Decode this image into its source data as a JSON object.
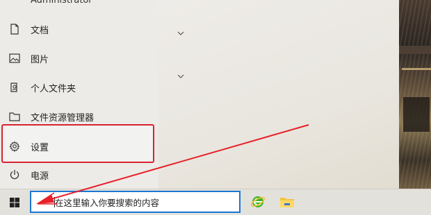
{
  "start_menu": {
    "user_name": "Administrator",
    "items": [
      {
        "label": "文档",
        "icon": "document-icon"
      },
      {
        "label": "图片",
        "icon": "picture-icon"
      },
      {
        "label": "个人文件夹",
        "icon": "user-folder-icon"
      },
      {
        "label": "文件资源管理器",
        "icon": "folder-icon"
      },
      {
        "label": "设置",
        "icon": "gear-icon"
      },
      {
        "label": "电源",
        "icon": "power-icon"
      }
    ]
  },
  "taskbar": {
    "search_placeholder": "在这里输入你要搜索的内容",
    "apps": [
      "internet-explorer-icon",
      "file-explorer-icon"
    ]
  },
  "annotation": {
    "arrow_color": "#e8202a",
    "highlight_color": "#d9232e"
  }
}
